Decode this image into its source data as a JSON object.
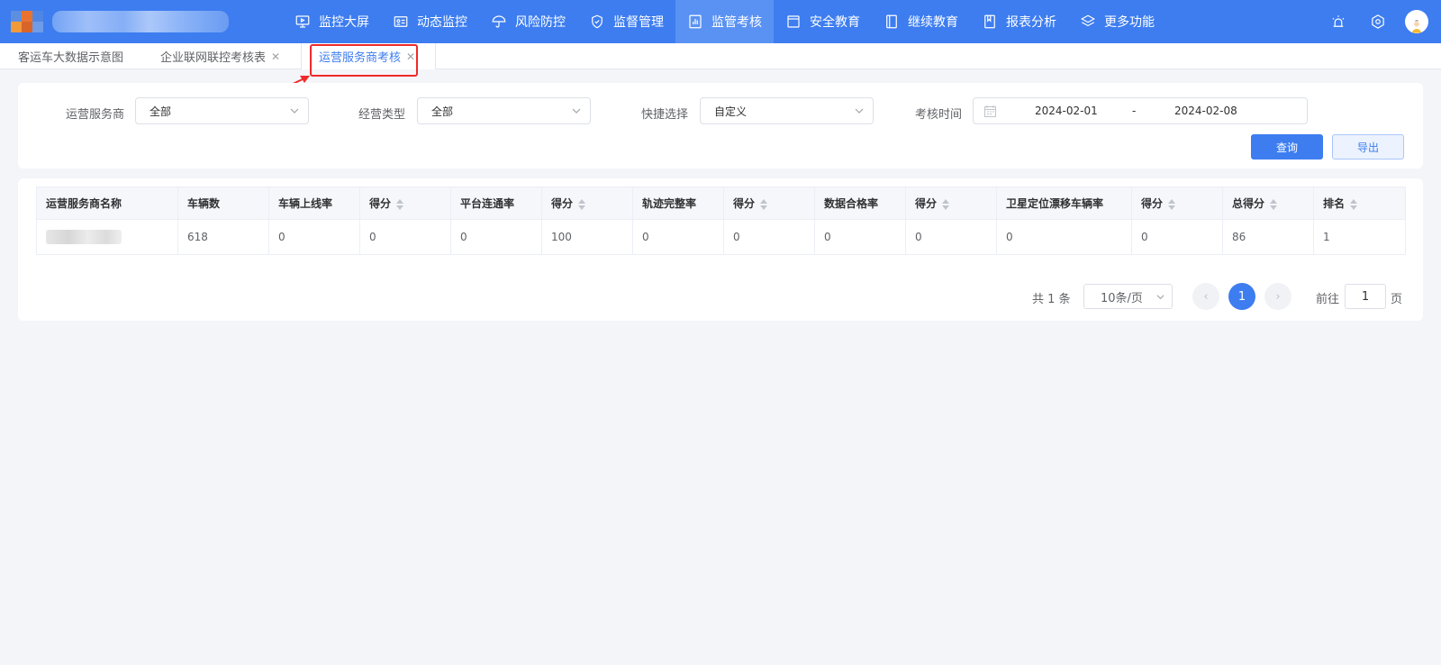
{
  "nav": {
    "items": [
      {
        "label": "监控大屏",
        "icon": "monitor-icon"
      },
      {
        "label": "动态监控",
        "icon": "id-card-icon"
      },
      {
        "label": "风险防控",
        "icon": "umbrella-icon"
      },
      {
        "label": "监督管理",
        "icon": "shield-icon"
      },
      {
        "label": "监管考核",
        "icon": "bar-chart-icon",
        "active": true
      },
      {
        "label": "安全教育",
        "icon": "browser-icon"
      },
      {
        "label": "继续教育",
        "icon": "notebook-icon"
      },
      {
        "label": "报表分析",
        "icon": "bookmark-icon"
      },
      {
        "label": "更多功能",
        "icon": "layers-icon"
      }
    ]
  },
  "tabs": [
    {
      "label": "客运车大数据示意图",
      "closable": false
    },
    {
      "label": "企业联网联控考核表",
      "closable": true
    },
    {
      "label": "运营服务商考核",
      "closable": true,
      "active": true
    }
  ],
  "filters": {
    "provider": {
      "label": "运营服务商",
      "value": "全部"
    },
    "business_type": {
      "label": "经营类型",
      "value": "全部"
    },
    "quick_select": {
      "label": "快捷选择",
      "value": "自定义"
    },
    "exam_time": {
      "label": "考核时间",
      "start": "2024-02-01",
      "separator": "-",
      "end": "2024-02-08"
    }
  },
  "buttons": {
    "query": "查询",
    "export": "导出"
  },
  "table": {
    "headers": [
      "运营服务商名称",
      "车辆数",
      "车辆上线率",
      "得分",
      "平台连通率",
      "得分",
      "轨迹完整率",
      "得分",
      "数据合格率",
      "得分",
      "卫星定位漂移车辆率",
      "得分",
      "总得分",
      "排名"
    ],
    "rows": [
      [
        "",
        "618",
        "0",
        "0",
        "0",
        "100",
        "0",
        "0",
        "0",
        "0",
        "0",
        "0",
        "86",
        "1"
      ]
    ]
  },
  "pagination": {
    "total": "共 1 条",
    "page_size": "10条/页",
    "current_page": "1",
    "goto_label": "前往",
    "goto_value": "1",
    "goto_suffix": "页"
  },
  "colors": {
    "primary": "#3d7df0",
    "highlight": "#f02a2a",
    "background": "#f4f5f9"
  }
}
